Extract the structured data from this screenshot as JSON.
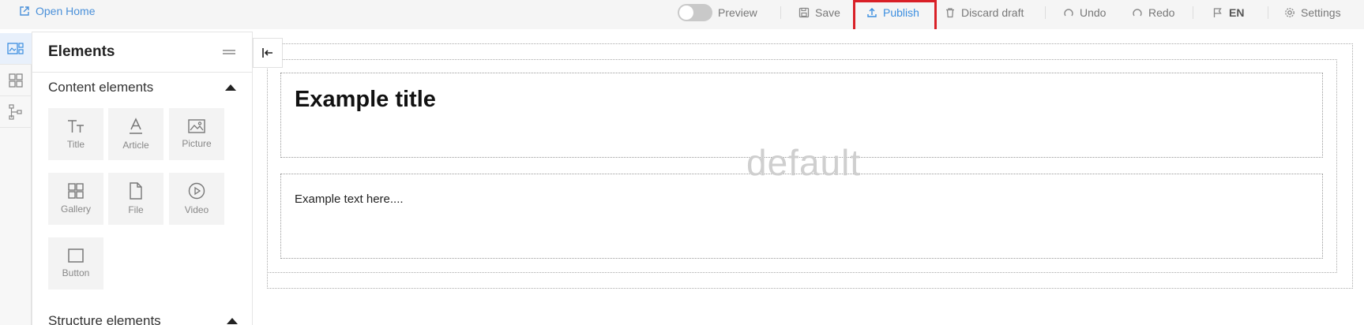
{
  "topbar": {
    "open_home": "Open Home",
    "preview": "Preview",
    "save": "Save",
    "publish": "Publish",
    "discard": "Discard draft",
    "undo": "Undo",
    "redo": "Redo",
    "lang": "EN",
    "settings": "Settings"
  },
  "panel": {
    "title": "Elements",
    "content_section": "Content elements",
    "structure_section": "Structure elements",
    "elements": [
      {
        "label": "Title",
        "icon": "title-icon"
      },
      {
        "label": "Article",
        "icon": "article-icon"
      },
      {
        "label": "Picture",
        "icon": "picture-icon"
      },
      {
        "label": "Gallery",
        "icon": "gallery-icon"
      },
      {
        "label": "File",
        "icon": "file-icon"
      },
      {
        "label": "Video",
        "icon": "video-icon"
      },
      {
        "label": "Button",
        "icon": "button-icon"
      }
    ]
  },
  "canvas": {
    "title": "Example title",
    "text": "Example text here....",
    "watermark": "default"
  },
  "colors": {
    "accent": "#3b8ee0",
    "highlight": "#d92027"
  }
}
